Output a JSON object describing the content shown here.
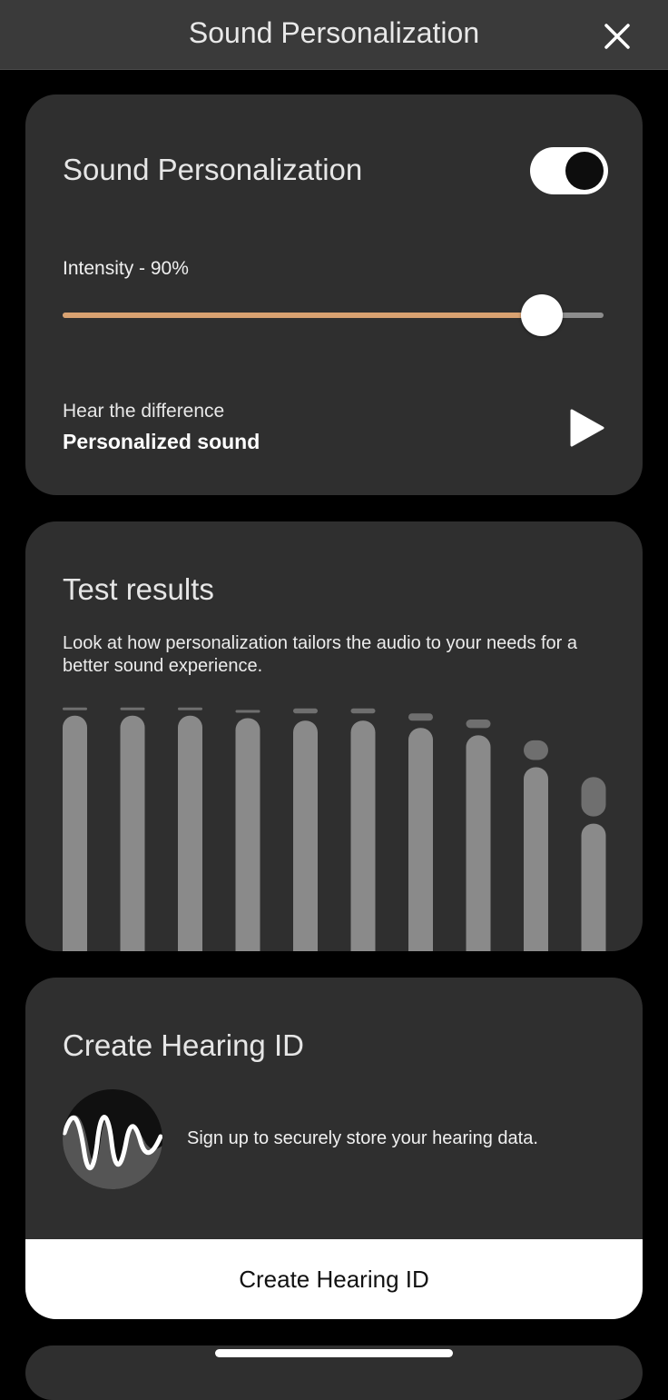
{
  "header": {
    "title": "Sound Personalization",
    "close_icon": "close-icon"
  },
  "personalization": {
    "title": "Sound Personalization",
    "toggle_on": true,
    "intensity_label": "Intensity - 90%",
    "intensity_value": 0.9,
    "hear_subtitle": "Hear the difference",
    "hear_title": "Personalized sound",
    "play_icon": "play-icon"
  },
  "test_results": {
    "title": "Test results",
    "description": "Look at how personalization tailors the audio to your needs for a better sound experience.",
    "bars": [
      {
        "level": 0.96,
        "boost": 0.005
      },
      {
        "level": 0.96,
        "boost": 0.005
      },
      {
        "level": 0.96,
        "boost": 0.005
      },
      {
        "level": 0.95,
        "boost": 0.01
      },
      {
        "level": 0.94,
        "boost": 0.02
      },
      {
        "level": 0.94,
        "boost": 0.02
      },
      {
        "level": 0.91,
        "boost": 0.03
      },
      {
        "level": 0.88,
        "boost": 0.035
      },
      {
        "level": 0.75,
        "boost": 0.08
      },
      {
        "level": 0.52,
        "boost": 0.16
      }
    ],
    "colors": {
      "bar": "#8a8a8a",
      "boost": "#6f6f6f"
    }
  },
  "hearing_id": {
    "title": "Create Hearing ID",
    "text": "Sign up to securely store your hearing data.",
    "button_label": "Create Hearing ID",
    "wave_icon": "hearing-wave-icon"
  },
  "colors": {
    "accent": "#d9a271",
    "card": "#2f2f2f",
    "topbar": "#3a3a3a"
  }
}
